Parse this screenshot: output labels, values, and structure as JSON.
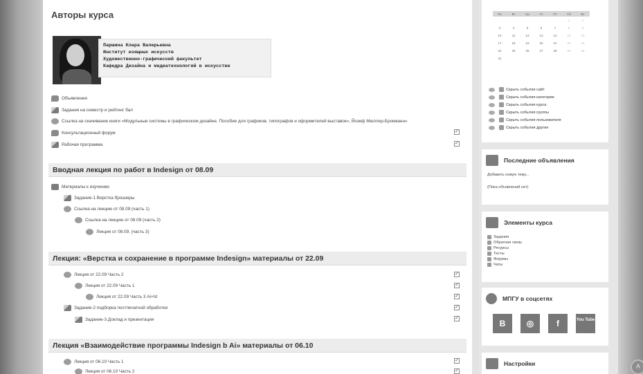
{
  "page": {
    "title": "Авторы курса"
  },
  "author": {
    "lines": [
      "Паршина Клара Валерьевна",
      "Институт изящных искусств",
      "Художественно-графический факультет",
      "Кафедра Дизайна и медиатехнологий в искусстве"
    ]
  },
  "general_activities": [
    {
      "label": "Объявления",
      "icon": "forum-icon",
      "check": false
    },
    {
      "label": "Задания на семестр и рейтинг бал",
      "icon": "assignment-icon",
      "check": false
    },
    {
      "label": "Ссылка на скачивание книги «Модульные системы в графическом дизайне. Пособие для графиков, типографов и оформителей выставок», Йозеф Мюллер-Брокманн»",
      "icon": "resource-icon",
      "check": false
    },
    {
      "label": "Консультационный форум",
      "icon": "forum-icon",
      "check": true
    },
    {
      "label": "Рабочая программа",
      "icon": "assignment-icon",
      "check": true
    }
  ],
  "sections": [
    {
      "title": "Вводная лекция по работ в Indesign от 08.09",
      "items": [
        {
          "label": "Материалы к изучению",
          "icon": "folder-icon",
          "indent": 0,
          "check": false
        },
        {
          "label": "Задание-1 Верстка брошюры",
          "icon": "assignment-icon",
          "indent": 1,
          "check": false
        },
        {
          "label": "Ссылка на лекцию от 08.09 (часть 1)",
          "icon": "resource-icon",
          "indent": 1,
          "check": false
        },
        {
          "label": "Ссылка на лекцию от 08.09 (часть 2)",
          "icon": "resource-icon",
          "indent": 2,
          "check": false
        },
        {
          "label": "Лекция от 08.09. (часть 3)",
          "icon": "resource-icon",
          "indent": 3,
          "check": false
        }
      ]
    },
    {
      "title": "Лекция: «Верстка и сохранение в программе Indesign» материалы от 22.09",
      "items": [
        {
          "label": "Лекция от 22.09 Часть 2",
          "icon": "resource-icon",
          "indent": 1,
          "check": true
        },
        {
          "label": "Лекция от 22.09 Часть 1",
          "icon": "resource-icon",
          "indent": 2,
          "check": true
        },
        {
          "label": "Лекция от 22.09 Часть 3 Ai+Id",
          "icon": "resource-icon",
          "indent": 3,
          "check": true
        },
        {
          "label": "Задание-2 подборка постпечатной обработки",
          "icon": "assignment-icon",
          "indent": 1,
          "check": true
        },
        {
          "label": "Задание-3 Доклад и презентация",
          "icon": "assignment-icon",
          "indent": 2,
          "check": true
        }
      ]
    },
    {
      "title": "Лекция «Взаимодействие программы Indesign b Ai» материалы от 06.10",
      "items": [
        {
          "label": "Лекция от 06.10 Часть 1",
          "icon": "resource-icon",
          "indent": 1,
          "check": true
        },
        {
          "label": "Лекция от 06.10 Часть 2",
          "icon": "resource-icon",
          "indent": 2,
          "check": true
        }
      ]
    }
  ],
  "calendar": {
    "weekdays": [
      "Пн",
      "Вт",
      "Ср",
      "Чт",
      "Пт",
      "Сб",
      "Вс"
    ],
    "weeks": [
      [
        "",
        "",
        "",
        "",
        "",
        "1",
        "2"
      ],
      [
        "3",
        "4",
        "5",
        "6",
        "7",
        "8",
        "9"
      ],
      [
        "10",
        "11",
        "12",
        "13",
        "14",
        "15",
        "16"
      ],
      [
        "17",
        "18",
        "19",
        "20",
        "21",
        "22",
        "23"
      ],
      [
        "24",
        "25",
        "26",
        "27",
        "28",
        "29",
        "30"
      ],
      [
        "31",
        "",
        "",
        "",
        "",
        "",
        ""
      ]
    ],
    "filters": [
      "Скрыть события сайт",
      "Скрыть события категории",
      "Скрыть события курса",
      "Скрыть события группы",
      "Скрыть события пользователя",
      "Скрыть события другие"
    ]
  },
  "news": {
    "title": "Последние объявления",
    "add_link": "Добавить новую тему...",
    "empty": "(Пока объявлений нет)"
  },
  "elements": {
    "title": "Элементы курса",
    "items": [
      "Задания",
      "Обратная связь",
      "Ресурсы",
      "Тесты",
      "Форумы",
      "Чаты"
    ]
  },
  "social": {
    "title": "МПГУ в соцсетях",
    "items": [
      "B",
      "◎",
      "f",
      "You Tube"
    ]
  },
  "settings": {
    "title": "Настройки"
  }
}
